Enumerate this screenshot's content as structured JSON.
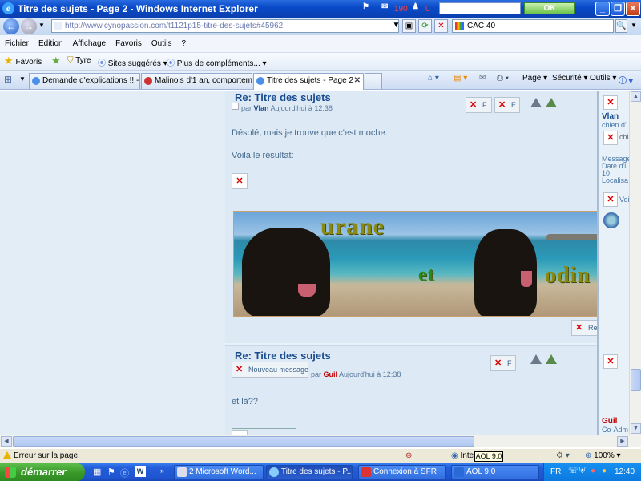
{
  "window": {
    "title": "Titre des sujets - Page 2 - Windows Internet Explorer",
    "counter_mail": "190",
    "counter_alerts": "0",
    "ok_label": "OK"
  },
  "address": {
    "url": "http://www.cynopassion.com/t1121p15-titre-des-sujets#45962",
    "search_value": "CAC 40"
  },
  "menu": [
    "Fichier",
    "Edition",
    "Affichage",
    "Favoris",
    "Outils",
    "?"
  ],
  "favorites": {
    "favoris": "Favoris",
    "tyre": "Tyre",
    "suggested": "Sites suggérés",
    "addons": "Plus de compléments..."
  },
  "tabs": [
    {
      "label": "Demande d'explications !! - P..."
    },
    {
      "label": "Malinois d'1 an, comporteme..."
    },
    {
      "label": "Titre des sujets - Page 2"
    }
  ],
  "commands": {
    "page": "Page",
    "security": "Sécurité",
    "tools": "Outils"
  },
  "post1": {
    "title": "Re: Titre des sujets",
    "meta_prefix": "par",
    "author": "Vlan",
    "date": "Aujourd'hui à 12:38",
    "line1": "Désolé, mais je trouve que c'est moche.",
    "line2": "Voila le résultat:",
    "btn_f": "F",
    "btn_e": "E",
    "back_top": "Revenir en ha"
  },
  "banner": {
    "word1": "urane",
    "word2": "et",
    "word3": "odin"
  },
  "post2": {
    "title": "Re: Titre des sujets",
    "new_message": "Nouveau message",
    "meta_prefix": "par",
    "author": "Guil",
    "date": "Aujourd'hui à 12:38",
    "text": "et là??",
    "btn_f": "F"
  },
  "sidebar": {
    "user1": "Vlan",
    "user1_rank": "chien d'",
    "chi": "chi",
    "messages": "Message",
    "date": "Date d'i",
    "count": "10",
    "location": "Localisa",
    "voir": "Voi",
    "user2": "Guil",
    "user2_rank": "Co-Adm"
  },
  "status": {
    "error": "Erreur sur la page.",
    "zone": "Inte",
    "zoom": "100%",
    "tooltip": "AOL 9.0"
  },
  "taskbar": {
    "start": "démarrer",
    "tasks": [
      {
        "label": "2 Microsoft Word..."
      },
      {
        "label": "Titre des sujets - P..."
      },
      {
        "label": "Connexion à SFR"
      },
      {
        "label": "AOL 9.0"
      }
    ],
    "lang": "FR",
    "clock": "12:40"
  }
}
